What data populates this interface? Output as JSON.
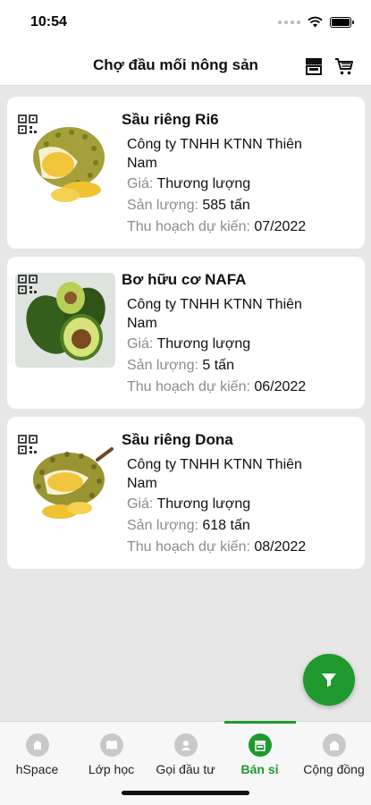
{
  "status_bar": {
    "time": "10:54"
  },
  "header": {
    "title": "Chợ đầu mối nông sản",
    "store_icon": "store-icon",
    "cart_icon": "cart-icon"
  },
  "labels": {
    "price": "Giá:",
    "yield": "Sản lượng:",
    "harvest": "Thu hoạch dự kiến:"
  },
  "products": [
    {
      "name": "Sầu riêng Ri6",
      "company": "Công ty TNHH KTNN Thiên Nam",
      "price": "Thương lượng",
      "yield": "585 tấn",
      "harvest": "07/2022"
    },
    {
      "name": "Bơ hữu cơ NAFA",
      "company": "Công ty TNHH KTNN Thiên Nam",
      "price": "Thương lượng",
      "yield": "5 tấn",
      "harvest": "06/2022"
    },
    {
      "name": "Sầu riêng Dona",
      "company": "Công ty TNHH KTNN Thiên Nam",
      "price": "Thương lượng",
      "yield": "618 tấn",
      "harvest": "08/2022"
    }
  ],
  "fab": {
    "icon": "filter-icon"
  },
  "tabs": [
    {
      "label": "hSpace",
      "icon": "hspace-icon"
    },
    {
      "label": "Lớp học",
      "icon": "book-icon"
    },
    {
      "label": "Gọi đầu tư",
      "icon": "invest-icon"
    },
    {
      "label": "Bán sỉ",
      "icon": "store-icon",
      "active": true
    },
    {
      "label": "Cộng đồng",
      "icon": "community-icon"
    }
  ],
  "colors": {
    "accent": "#1f9a2e",
    "background": "#e6e7e6",
    "muted_label": "#8c8c8c"
  }
}
